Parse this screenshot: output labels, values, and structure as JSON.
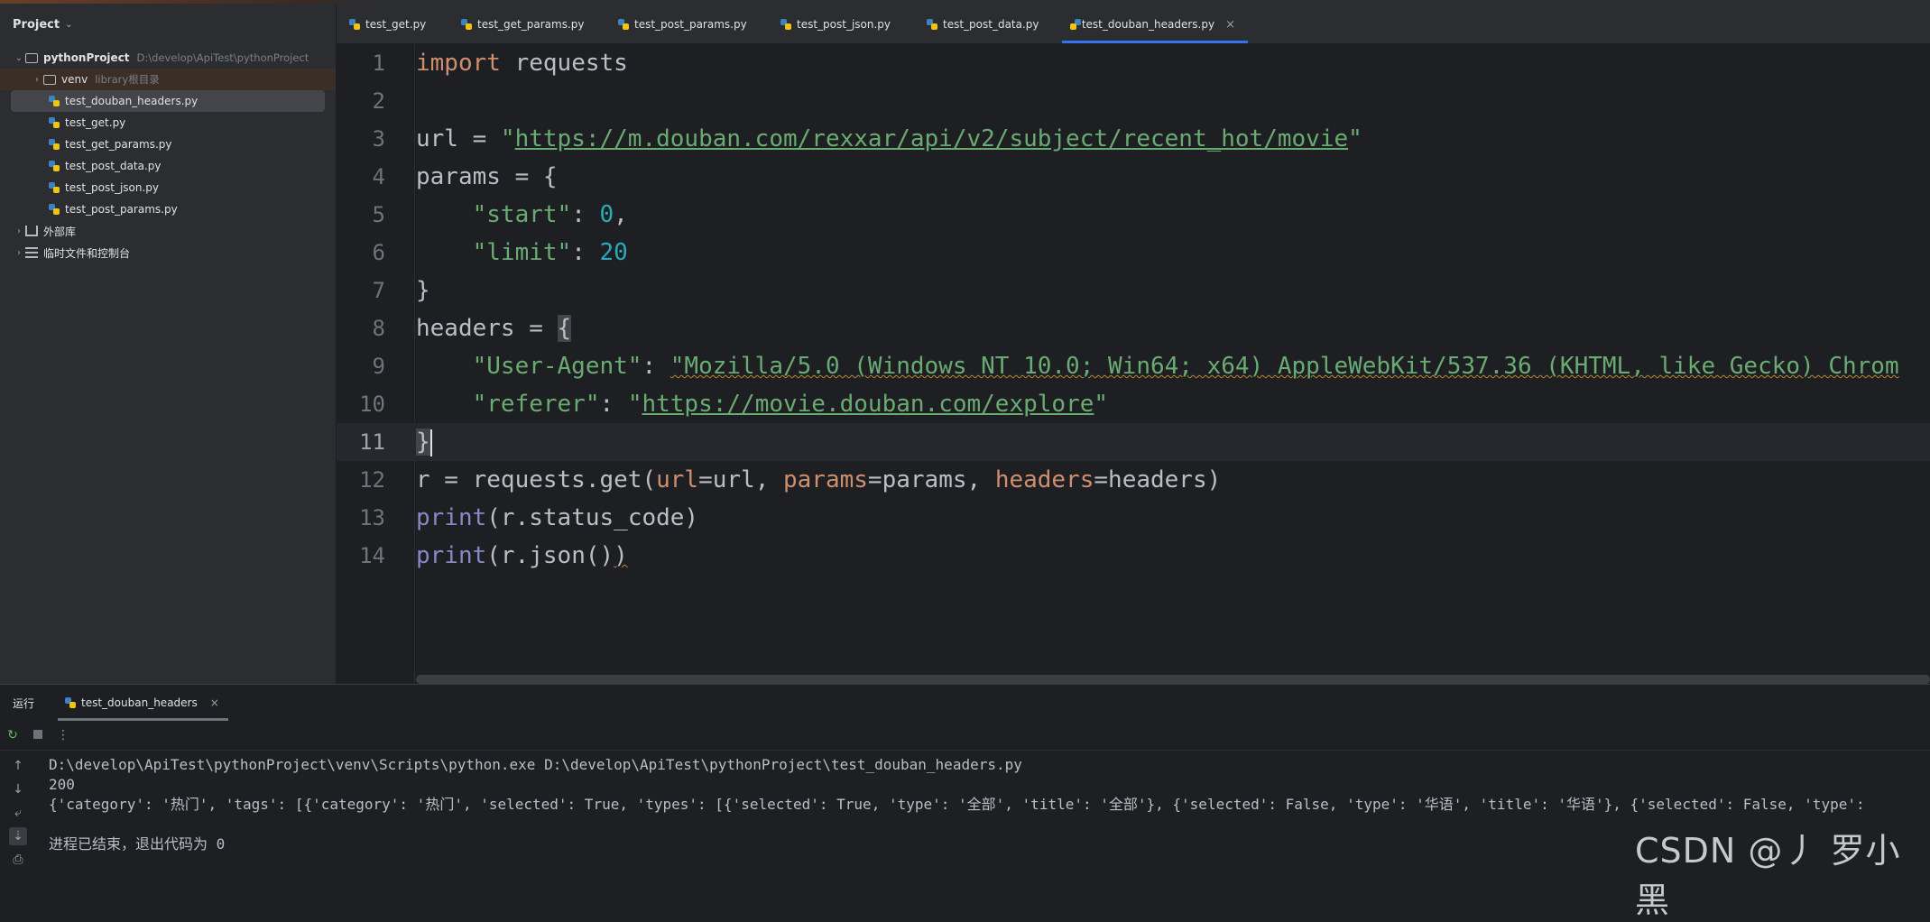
{
  "sidebar": {
    "title": "Project",
    "root": {
      "name": "pythonProject",
      "path": "D:\\develop\\ApiTest\\pythonProject"
    },
    "venv": {
      "name": "venv",
      "hint": "library根目录"
    },
    "files": [
      "test_douban_headers.py",
      "test_get.py",
      "test_get_params.py",
      "test_post_data.py",
      "test_post_json.py",
      "test_post_params.py"
    ],
    "external_libs": "外部库",
    "scratches": "临时文件和控制台"
  },
  "tabs": [
    "test_get.py",
    "test_get_params.py",
    "test_post_params.py",
    "test_post_json.py",
    "test_post_data.py",
    "test_douban_headers.py"
  ],
  "editor": {
    "line_numbers": [
      "1",
      "2",
      "3",
      "4",
      "5",
      "6",
      "7",
      "8",
      "9",
      "10",
      "11",
      "12",
      "13",
      "14"
    ],
    "tokens": {
      "import_kw": "import",
      "import_mod": " requests",
      "url_var": "url = ",
      "url_q1": "\"",
      "url_value": "https://m.douban.com/rexxar/api/v2/subject/recent_hot/movie",
      "url_q2": "\"",
      "params_open": "params = {",
      "start_key": "    \"start\"",
      "colon_sp": ": ",
      "start_val": "0",
      "comma": ",",
      "limit_key": "    \"limit\"",
      "limit_val": "20",
      "close_brace": "}",
      "headers_open": "headers = ",
      "open_brace": "{",
      "ua_key": "    \"User-Agent\"",
      "ua_val": "\"Mozilla/5.0 (Windows NT 10.0; Win64; x64) AppleWebKit/537.36 (KHTML, like Gecko) Chrom",
      "ref_key": "    \"referer\"",
      "ref_q1": "\"",
      "ref_url": "https://movie.douban.com/explore",
      "ref_q2": "\"",
      "req_a": "r = requests.get(",
      "req_url_kw": "url",
      "req_b": "=url, ",
      "req_params_kw": "params",
      "req_c": "=params, ",
      "req_headers_kw": "headers",
      "req_d": "=headers)",
      "print_fn": "print",
      "print1_rest": "(r.status_code)",
      "print2_a": "(r.json()",
      "print2_b": ")"
    }
  },
  "run": {
    "title": "运行",
    "tab": "test_douban_headers",
    "output": [
      "D:\\develop\\ApiTest\\pythonProject\\venv\\Scripts\\python.exe D:\\develop\\ApiTest\\pythonProject\\test_douban_headers.py",
      "200",
      "{'category': '热门', 'tags': [{'category': '热门', 'selected': True, 'types': [{'selected': True, 'type': '全部', 'title': '全部'}, {'selected': False, 'type': '华语', 'title': '华语'}, {'selected': False, 'type':",
      "",
      "进程已结束，退出代码为 0"
    ]
  },
  "watermark": "CSDN @丿 罗小黑"
}
